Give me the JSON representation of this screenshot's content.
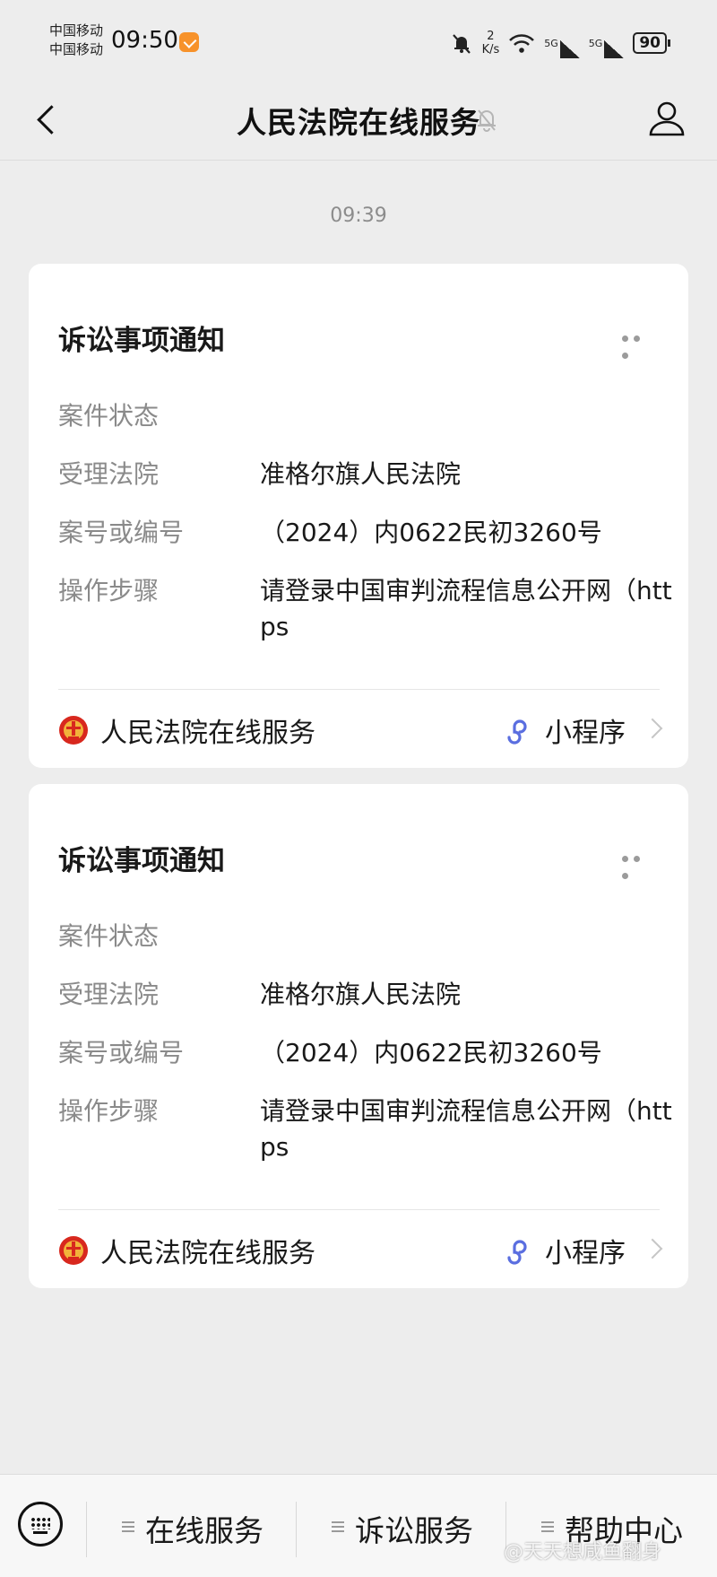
{
  "status_bar": {
    "carrier_1": "中国移动",
    "carrier_2": "中国移动",
    "time": "09:50",
    "speed_value": "2",
    "speed_unit": "K/s",
    "sig1": "5G",
    "sig2": "5G",
    "battery": "90"
  },
  "nav": {
    "title": "人民法院在线服务"
  },
  "chat": {
    "timestamp": "09:39"
  },
  "cards": [
    {
      "title": "诉讼事项通知",
      "rows": [
        {
          "label": "案件状态",
          "value": ""
        },
        {
          "label": "受理法院",
          "value": "准格尔旗人民法院"
        },
        {
          "label": "案号或编号",
          "value": "（2024）内0622民初3260号"
        },
        {
          "label": "操作步骤",
          "value": "请登录中国审判流程信息公开网（https"
        }
      ],
      "footer_name": "人民法院在线服务",
      "footer_link": "小程序"
    },
    {
      "title": "诉讼事项通知",
      "rows": [
        {
          "label": "案件状态",
          "value": ""
        },
        {
          "label": "受理法院",
          "value": "准格尔旗人民法院"
        },
        {
          "label": "案号或编号",
          "value": "（2024）内0622民初3260号"
        },
        {
          "label": "操作步骤",
          "value": "请登录中国审判流程信息公开网（https"
        }
      ],
      "footer_name": "人民法院在线服务",
      "footer_link": "小程序"
    }
  ],
  "bottom_menu": {
    "items": [
      "在线服务",
      "诉讼服务",
      "帮助中心"
    ]
  },
  "watermark": "@天天想咸鱼翻身",
  "colors": {
    "background": "#ededed",
    "card": "#ffffff",
    "label_gray": "#8a8a8a",
    "mini_program_blue": "#5a6ee0",
    "court_emblem_red": "#d8281e"
  }
}
